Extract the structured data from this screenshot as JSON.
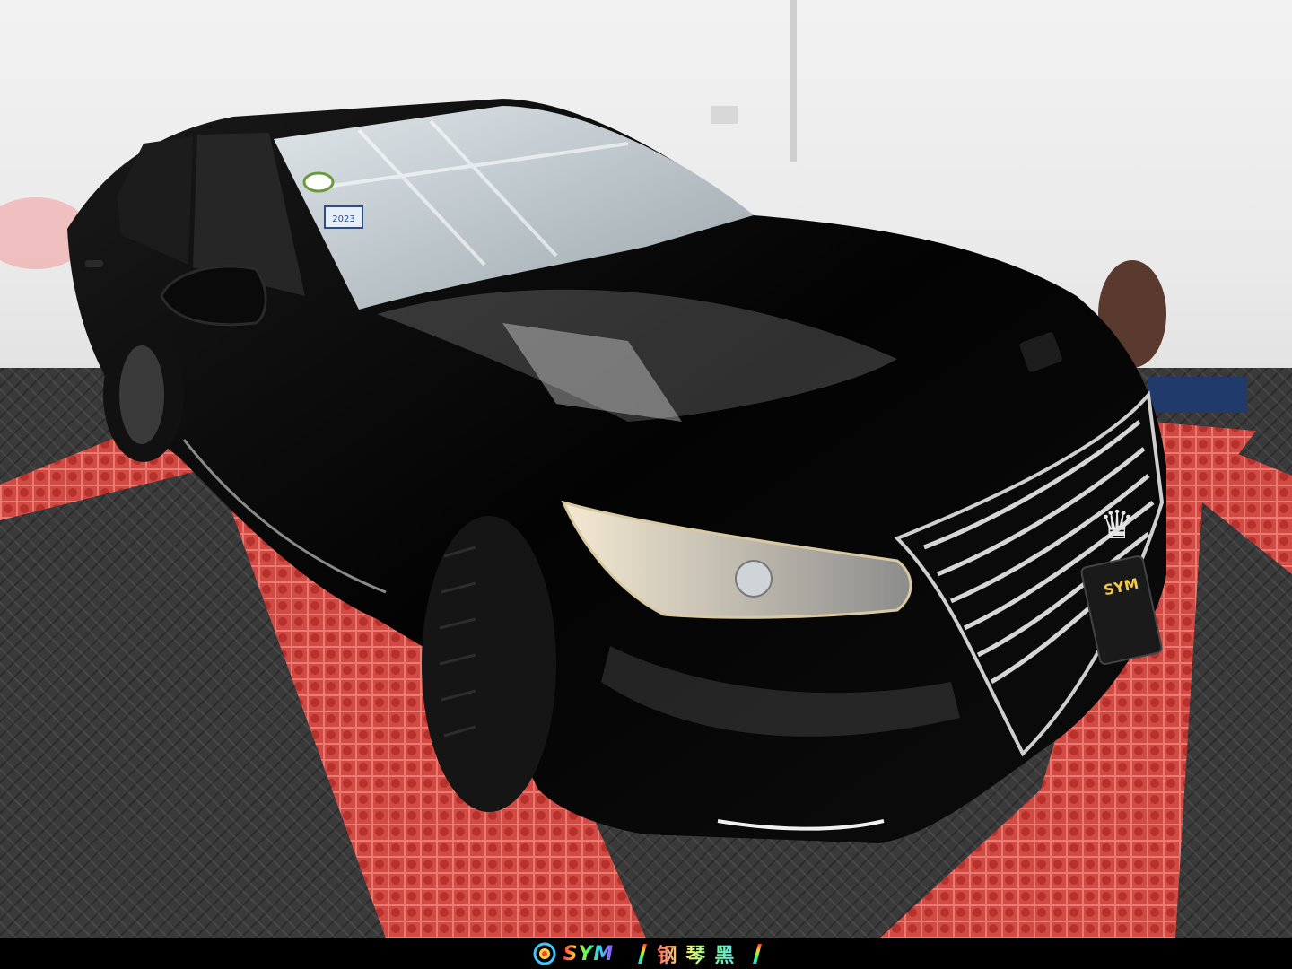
{
  "scene": {
    "description_colors": {
      "wall": "#eeeeee",
      "floor_mat_red": "#d9534f",
      "floor_grey": "#3a3a3a",
      "car_body": "#050505"
    }
  },
  "windshield_sticker": {
    "year": "2023"
  },
  "plate_badge": {
    "text": "SYM"
  },
  "footer": {
    "brand": "SYM",
    "slogan": "钢琴黑"
  }
}
